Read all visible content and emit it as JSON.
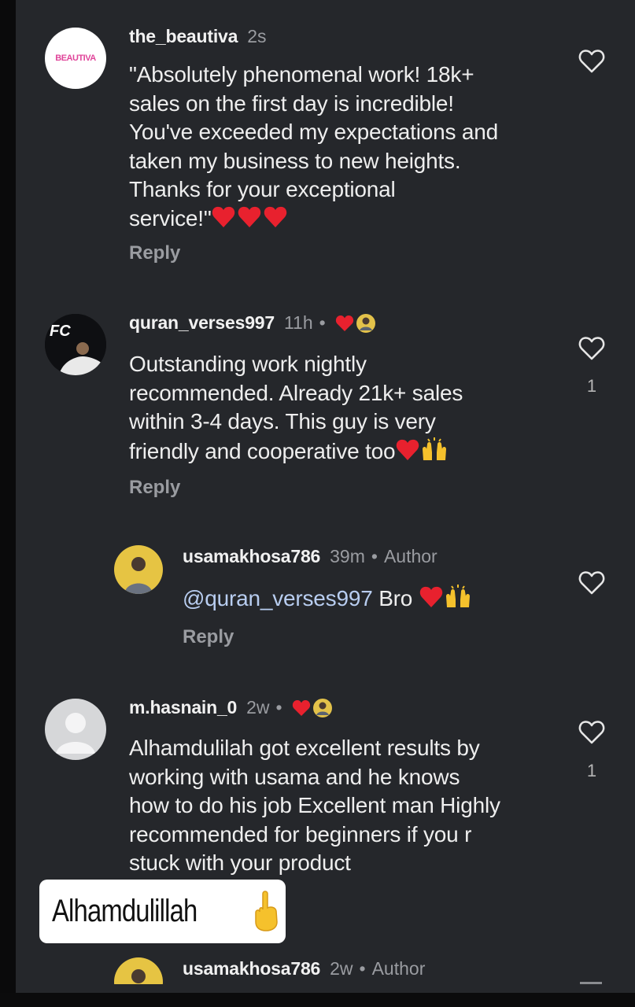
{
  "comments": [
    {
      "username": "the_beautiva",
      "time": "2s",
      "avatar_text": "BEAUTIVA",
      "text_lines": [
        "\"Absolutely phenomenal work! 18k+",
        "sales on the first day is incredible!",
        "You've exceeded my expectations and",
        "taken my business to new heights.",
        "Thanks for your exceptional",
        "service!\""
      ],
      "reply_label": "Reply"
    },
    {
      "username": "quran_verses997",
      "time": "11h",
      "avatar_text": "FC",
      "text_lines": [
        "Outstanding work nightly",
        "recommended. Already 21k+ sales",
        "within 3-4 days. This guy is very",
        "friendly and cooperative too"
      ],
      "reply_label": "Reply",
      "like_count": "1"
    },
    {
      "username": "usamakhosa786",
      "time": "39m",
      "author_label": "Author",
      "mention": "@quran_verses997",
      "text_after": "Bro",
      "reply_label": "Reply"
    },
    {
      "username": "m.hasnain_0",
      "time": "2w",
      "text_lines": [
        "Alhamdulilah got excellent results by",
        "working with usama  and he knows",
        "how to do his job Excellent man Highly",
        "recommended for beginners if you r",
        "stuck with your product"
      ],
      "like_count": "1"
    },
    {
      "username": "usamakhosa786",
      "time": "2w",
      "author_label": "Author"
    }
  ],
  "sticker": {
    "text": "Alhamdulillah"
  },
  "colors": {
    "background": "#25272b",
    "heart_red": "#e8212e",
    "mention": "#b8cdf0"
  }
}
